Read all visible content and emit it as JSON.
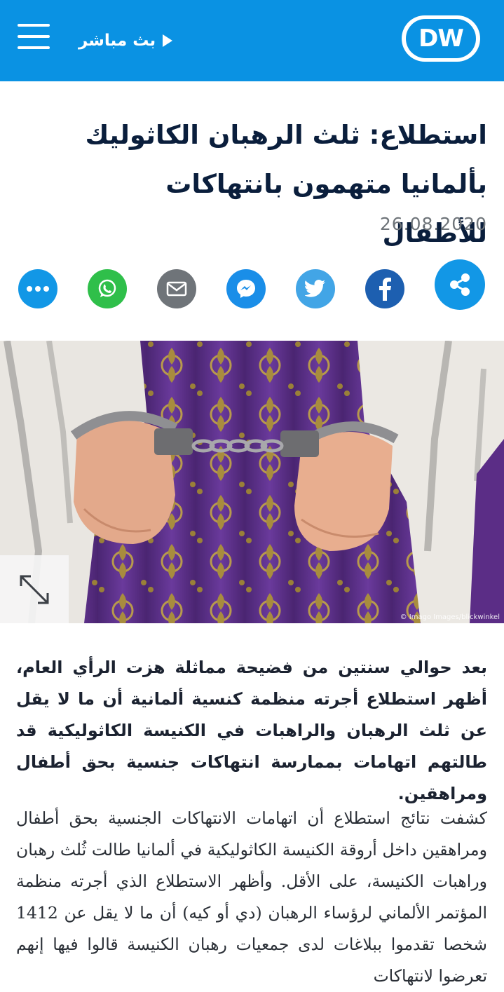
{
  "header": {
    "live_label": "بث مباشر",
    "logo_text": "DW",
    "bg_color": "#0a92e3"
  },
  "article": {
    "title": "استطلاع: ثلث الرهبان الكاثوليك بألمانيا متهمون بانتهاكات للأطفال",
    "date": "26.08.2020",
    "image_credit": "© Imago Images/blickwinkel",
    "lead": "بعد حوالي سنتين من فضيحة مماثلة هزت الرأي العام، أظهر استطلاع أجرته منظمة كنسية ألمانية أن ما لا يقل عن ثلث الرهبان والراهبات في الكنيسة الكاثوليكية قد طالتهم اتهامات بممارسة انتهاكات جنسية بحق أطفال ومراهقين.",
    "body": "كشفت نتائج استطلاع أن اتهامات الانتهاكات الجنسية بحق أطفال ومراهقين داخل أروقة الكنيسة الكاثوليكية في ألمانيا طالت ثُلث رهبان وراهبات الكنيسة، على الأقل. وأظهر الاستطلاع الذي أجرته منظمة المؤتمر الألماني لرؤساء الرهبان (دي أو كيه) أن ما لا يقل عن 1412 شخصا تقدموا ببلاغات لدى جمعيات رهبان الكنيسة قالوا فيها إنهم تعرضوا لانتهاكات"
  },
  "share_buttons": [
    {
      "name": "share",
      "icon": "share-icon",
      "color": "#1297e6"
    },
    {
      "name": "facebook",
      "icon": "facebook-icon",
      "color": "#1d5fb0"
    },
    {
      "name": "twitter",
      "icon": "twitter-icon",
      "color": "#42a5e6"
    },
    {
      "name": "messenger",
      "icon": "messenger-icon",
      "color": "#1a8ee8"
    },
    {
      "name": "email",
      "icon": "email-icon",
      "color": "#6f7479"
    },
    {
      "name": "whatsapp",
      "icon": "whatsapp-icon",
      "color": "#2fbf4a"
    },
    {
      "name": "more",
      "icon": "more-dots-icon",
      "color": "#1297e6"
    }
  ]
}
